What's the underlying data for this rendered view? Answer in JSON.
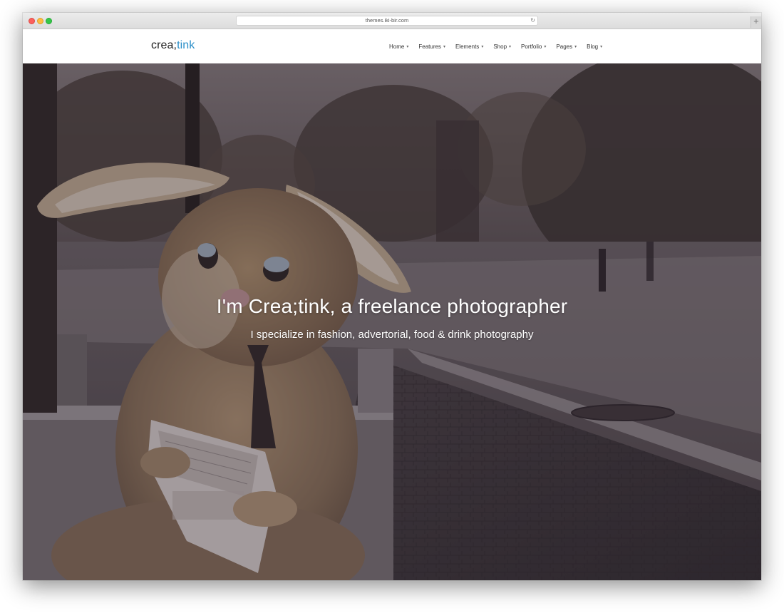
{
  "browser": {
    "url": "themes.iki-bir.com",
    "reload_icon": "reload-icon",
    "new_tab_glyph": "+"
  },
  "site": {
    "logo_prefix": "crea;",
    "logo_suffix": "tink",
    "accent_color": "#2c8fc9"
  },
  "nav": {
    "items": [
      {
        "label": "Home"
      },
      {
        "label": "Features"
      },
      {
        "label": "Elements"
      },
      {
        "label": "Shop"
      },
      {
        "label": "Portfolio"
      },
      {
        "label": "Pages"
      },
      {
        "label": "Blog"
      }
    ],
    "chevron_icon": "chevron-down-icon"
  },
  "hero": {
    "title": "I'm Crea;tink, a freelance photographer",
    "subtitle": "I specialize in fashion, advertorial, food & drink photography"
  }
}
